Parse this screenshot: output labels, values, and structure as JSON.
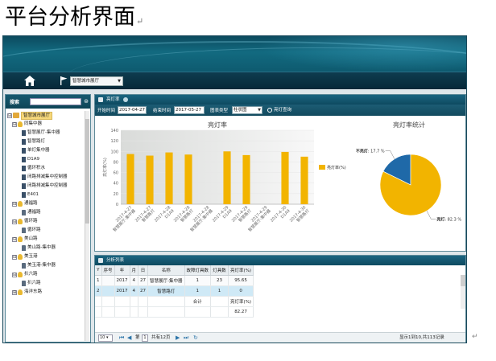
{
  "doc": {
    "title": "平台分析界面",
    "para_mark": "↵"
  },
  "nav": {
    "hall_select": "智慧城市展厅",
    "home_icon": "home-icon",
    "flag_icon": "flag-icon"
  },
  "sidebar": {
    "search_label": "搜索",
    "root": "智慧城市展厅",
    "tree": [
      {
        "label": "同集中器",
        "level": 1,
        "icon": "bulb",
        "toggle": "⊟"
      },
      {
        "label": "智慧展厅-集中器",
        "level": 2,
        "icon": "item"
      },
      {
        "label": "智慧路灯",
        "level": 2,
        "icon": "item"
      },
      {
        "label": "单灯集中器",
        "level": 2,
        "icon": "item"
      },
      {
        "label": "D1A9",
        "level": 2,
        "icon": "item"
      },
      {
        "label": "循环积水",
        "level": 2,
        "icon": "item"
      },
      {
        "label": "闭路排减集中控制器",
        "level": 2,
        "icon": "item"
      },
      {
        "label": "闭路排减集中控制器",
        "level": 2,
        "icon": "item"
      },
      {
        "label": "E401",
        "level": 2,
        "icon": "item"
      },
      {
        "label": "通福路",
        "level": 1,
        "icon": "bulb",
        "toggle": "⊟"
      },
      {
        "label": "通福路",
        "level": 2,
        "icon": "lamp"
      },
      {
        "label": "循环路",
        "level": 1,
        "icon": "bulb",
        "toggle": "⊟"
      },
      {
        "label": "循环路",
        "level": 2,
        "icon": "lamp"
      },
      {
        "label": "美山路",
        "level": 1,
        "icon": "bulb",
        "toggle": "⊟"
      },
      {
        "label": "美山路-集中器",
        "level": 2,
        "icon": "lamp"
      },
      {
        "label": "美玉港",
        "level": 1,
        "icon": "bulb",
        "toggle": "⊟"
      },
      {
        "label": "美玉港-集中器",
        "level": 2,
        "icon": "lamp"
      },
      {
        "label": "扒六路",
        "level": 1,
        "icon": "bulb",
        "toggle": "⊟"
      },
      {
        "label": "扒六路",
        "level": 2,
        "icon": "lamp"
      },
      {
        "label": "海洋东路",
        "level": 1,
        "icon": "bulb",
        "toggle": "⊞"
      }
    ]
  },
  "chart_panel": {
    "title": "亮灯率",
    "filter": {
      "start_label": "开始时间",
      "start_value": "2017-04-27",
      "end_label": "结束时间",
      "end_value": "2017-05-27",
      "type_label": "图表类型",
      "type_value": "柱状图",
      "query_label": "亮灯查询"
    }
  },
  "chart_data": [
    {
      "type": "bar",
      "title": "亮灯率",
      "ylabel": "亮灯率(%)",
      "ylim": [
        0,
        140
      ],
      "yticks": [
        0,
        20,
        40,
        60,
        80,
        100,
        120,
        140
      ],
      "categories": [
        "2017-4-27 智慧展厅-集中器",
        "2017-4-27 智慧路灯",
        "2017-4-28 D1A9",
        "2017-4-28 智慧路灯",
        "2017-4-28 智慧展厅-集中器",
        "2017-4-29 D1A9",
        "2017-4-29 智慧路灯",
        "2017-4-29 智慧展厅-集中器",
        "2017-4-30 D1A9",
        "2017-4-30 智慧路灯"
      ],
      "series": [
        {
          "name": "亮灯率(%)",
          "values": [
            95,
            92,
            98,
            94,
            0,
            100,
            93,
            0,
            99,
            90
          ]
        }
      ],
      "colors": {
        "bar": "#f2b400"
      }
    },
    {
      "type": "pie",
      "title": "亮灯率统计",
      "slices": [
        {
          "label": "不亮灯",
          "value": 17.7,
          "display": "17.7 %",
          "color": "#1f69a8"
        },
        {
          "label": "亮灯",
          "value": 82.3,
          "display": "82.3 %",
          "color": "#f2b400"
        }
      ]
    }
  ],
  "table_panel": {
    "title": "分析列表",
    "columns": [
      "Y",
      "序号",
      "年",
      "月",
      "日",
      "名称",
      "故障灯具数",
      "灯具数",
      "亮灯率(%)"
    ],
    "rows": [
      [
        "1",
        "",
        "2017",
        "4",
        "27",
        "智慧展厅-集中器",
        "1",
        "23",
        "95.65"
      ],
      [
        "2",
        "",
        "2017",
        "4",
        "27",
        "智慧路灯",
        "1",
        "1",
        "0"
      ]
    ],
    "summary_label_total": "合计",
    "summary_label_rate": "亮灯率(%)",
    "summary_value": "82.27"
  },
  "pager": {
    "page_size": "10",
    "page_prefix": "第",
    "page_value": "1",
    "page_suffix": "共有12页",
    "info": "显示1到10,共113记录"
  }
}
